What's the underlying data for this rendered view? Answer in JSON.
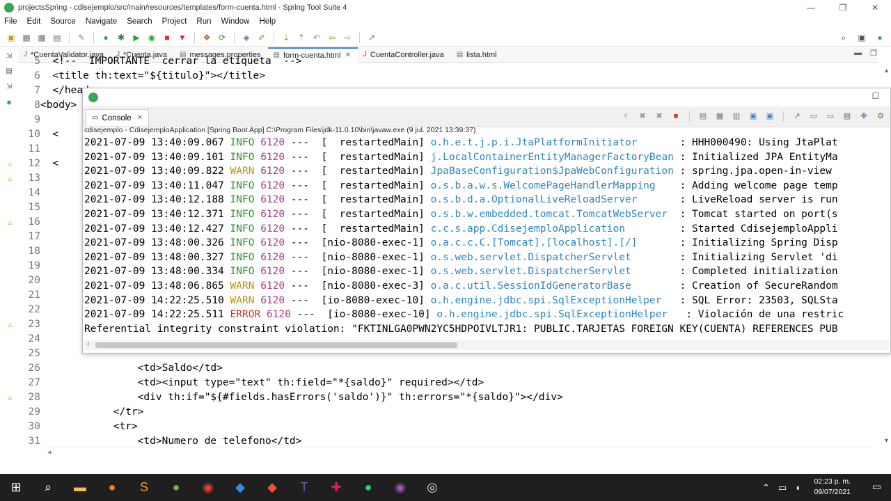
{
  "window": {
    "title": "projectsSpring - cdisejemplo/src/main/resources/templates/form-cuenta.html - Spring Tool Suite 4",
    "minimize": "—",
    "maximize": "❐",
    "close": "✕"
  },
  "menu": [
    "File",
    "Edit",
    "Source",
    "Navigate",
    "Search",
    "Project",
    "Run",
    "Window",
    "Help"
  ],
  "tabs": [
    {
      "label": "*CuentaValidator.java",
      "icon": "java-file-icon",
      "active": false
    },
    {
      "label": "*Cuenta.java",
      "icon": "java-file-icon",
      "active": false
    },
    {
      "label": "messages.properties",
      "icon": "properties-file-icon",
      "active": false
    },
    {
      "label": "form-cuenta.html",
      "icon": "html-file-icon",
      "active": true
    },
    {
      "label": "CuentaController.java",
      "icon": "java-file-icon",
      "active": false
    },
    {
      "label": "lista.html",
      "icon": "html-file-icon",
      "active": false
    }
  ],
  "editor": {
    "lines": [
      {
        "n": "5",
        "text": "  <!--  IMPORTANTE  cerrar la etiqueta  -->"
      },
      {
        "n": "6",
        "text": "  <title th:text=\"${titulo}\"></title>"
      },
      {
        "n": "7",
        "text": "  </head>"
      },
      {
        "n": "8",
        "text": "<body>"
      },
      {
        "n": "9",
        "text": ""
      },
      {
        "n": "10",
        "text": "  <"
      },
      {
        "n": "11",
        "text": ""
      },
      {
        "n": "12",
        "text": "  <"
      },
      {
        "n": "13",
        "text": ""
      },
      {
        "n": "14",
        "text": ""
      },
      {
        "n": "15",
        "text": ""
      },
      {
        "n": "16",
        "text": ""
      },
      {
        "n": "17",
        "text": ""
      },
      {
        "n": "18",
        "text": ""
      },
      {
        "n": "19",
        "text": ""
      },
      {
        "n": "20",
        "text": ""
      },
      {
        "n": "21",
        "text": ""
      },
      {
        "n": "22",
        "text": ""
      },
      {
        "n": "23",
        "text": ""
      },
      {
        "n": "24",
        "text": ""
      },
      {
        "n": "25",
        "text": ""
      },
      {
        "n": "26",
        "text": "                <td>Saldo</td>"
      },
      {
        "n": "27",
        "text": "                <td><input type=\"text\" th:field=\"*{saldo}\" required></td>"
      },
      {
        "n": "28",
        "text": "                <div th:if=\"${#fields.hasErrors('saldo')}\" th:errors=\"*{saldo}\"></div>"
      },
      {
        "n": "29",
        "text": "            </tr>"
      },
      {
        "n": "30",
        "text": "            <tr>"
      },
      {
        "n": "31",
        "text": "                <td>Numero de telefono</td>"
      }
    ],
    "markers": {
      "12": "⚠",
      "13": "⚠",
      "16": "⚠",
      "23": "⚠",
      "28": "⚠"
    }
  },
  "console": {
    "tab_label": "Console",
    "launch": "cdisejemplo - CdisejemploApplication [Spring Boot App] C:\\Program Files\\jdk-11.0.10\\bin\\javaw.exe  (9 jul. 2021 13:39:37)",
    "rows": [
      {
        "ts": "2021-07-09 13:40:09.067",
        "level": "INFO",
        "pid": "6120",
        "thread": "---  [  restartedMain]",
        "logger": "o.h.e.t.j.p.i.JtaPlatformInitiator      ",
        "msg": ": HHH000490: Using JtaPlat"
      },
      {
        "ts": "2021-07-09 13:40:09.101",
        "level": "INFO",
        "pid": "6120",
        "thread": "---  [  restartedMain]",
        "logger": "j.LocalContainerEntityManagerFactoryBean",
        "msg": ": Initialized JPA EntityMa"
      },
      {
        "ts": "2021-07-09 13:40:09.822",
        "level": "WARN",
        "pid": "6120",
        "thread": "---  [  restartedMain]",
        "logger": "JpaBaseConfiguration$JpaWebConfiguration",
        "msg": ": spring.jpa.open-in-view"
      },
      {
        "ts": "2021-07-09 13:40:11.047",
        "level": "INFO",
        "pid": "6120",
        "thread": "---  [  restartedMain]",
        "logger": "o.s.b.a.w.s.WelcomePageHandlerMapping   ",
        "msg": ": Adding welcome page temp"
      },
      {
        "ts": "2021-07-09 13:40:12.188",
        "level": "INFO",
        "pid": "6120",
        "thread": "---  [  restartedMain]",
        "logger": "o.s.b.d.a.OptionalLiveReloadServer      ",
        "msg": ": LiveReload server is run"
      },
      {
        "ts": "2021-07-09 13:40:12.371",
        "level": "INFO",
        "pid": "6120",
        "thread": "---  [  restartedMain]",
        "logger": "o.s.b.w.embedded.tomcat.TomcatWebServer ",
        "msg": ": Tomcat started on port(s"
      },
      {
        "ts": "2021-07-09 13:40:12.427",
        "level": "INFO",
        "pid": "6120",
        "thread": "---  [  restartedMain]",
        "logger": "c.c.s.app.CdisejemploApplication        ",
        "msg": ": Started CdisejemploAppli"
      },
      {
        "ts": "2021-07-09 13:48:00.326",
        "level": "INFO",
        "pid": "6120",
        "thread": "---  [nio-8080-exec-1]",
        "logger": "o.a.c.c.C.[Tomcat].[localhost].[/]      ",
        "msg": ": Initializing Spring Disp"
      },
      {
        "ts": "2021-07-09 13:48:00.327",
        "level": "INFO",
        "pid": "6120",
        "thread": "---  [nio-8080-exec-1]",
        "logger": "o.s.web.servlet.DispatcherServlet       ",
        "msg": ": Initializing Servlet 'di"
      },
      {
        "ts": "2021-07-09 13:48:00.334",
        "level": "INFO",
        "pid": "6120",
        "thread": "---  [nio-8080-exec-1]",
        "logger": "o.s.web.servlet.DispatcherServlet       ",
        "msg": ": Completed initialization"
      },
      {
        "ts": "2021-07-09 13:48:06.865",
        "level": "WARN",
        "pid": "6120",
        "thread": "---  [nio-8080-exec-3]",
        "logger": "o.a.c.util.SessionIdGeneratorBase       ",
        "msg": ": Creation of SecureRandom"
      },
      {
        "ts": "2021-07-09 14:22:25.510",
        "level": "WARN",
        "pid": "6120",
        "thread": "---  [io-8080-exec-10]",
        "logger": "o.h.engine.jdbc.spi.SqlExceptionHelper  ",
        "msg": ": SQL Error: 23503, SQLSta"
      },
      {
        "ts": "2021-07-09 14:22:25.511",
        "level": "ERROR",
        "pid": "6120",
        "thread": "---  [io-8080-exec-10]",
        "logger": "o.h.engine.jdbc.spi.SqlExceptionHelper  ",
        "msg": ": Violación de una restric"
      }
    ],
    "tail_line": "Referential integrity constraint violation: \"FKTINLGA0PWN2YC5HDPOIVLTJR1: PUBLIC.TARJETAS FOREIGN KEY(CUENTA) REFERENCES PUB"
  },
  "taskbar": {
    "time": "02:23 p. m.",
    "date": "09/07/2021"
  },
  "colors": {
    "info": "#2f8f2f",
    "warn": "#b7950b",
    "error": "#c0392b",
    "logger": "#2e86c1",
    "pid": "#a53c91"
  }
}
